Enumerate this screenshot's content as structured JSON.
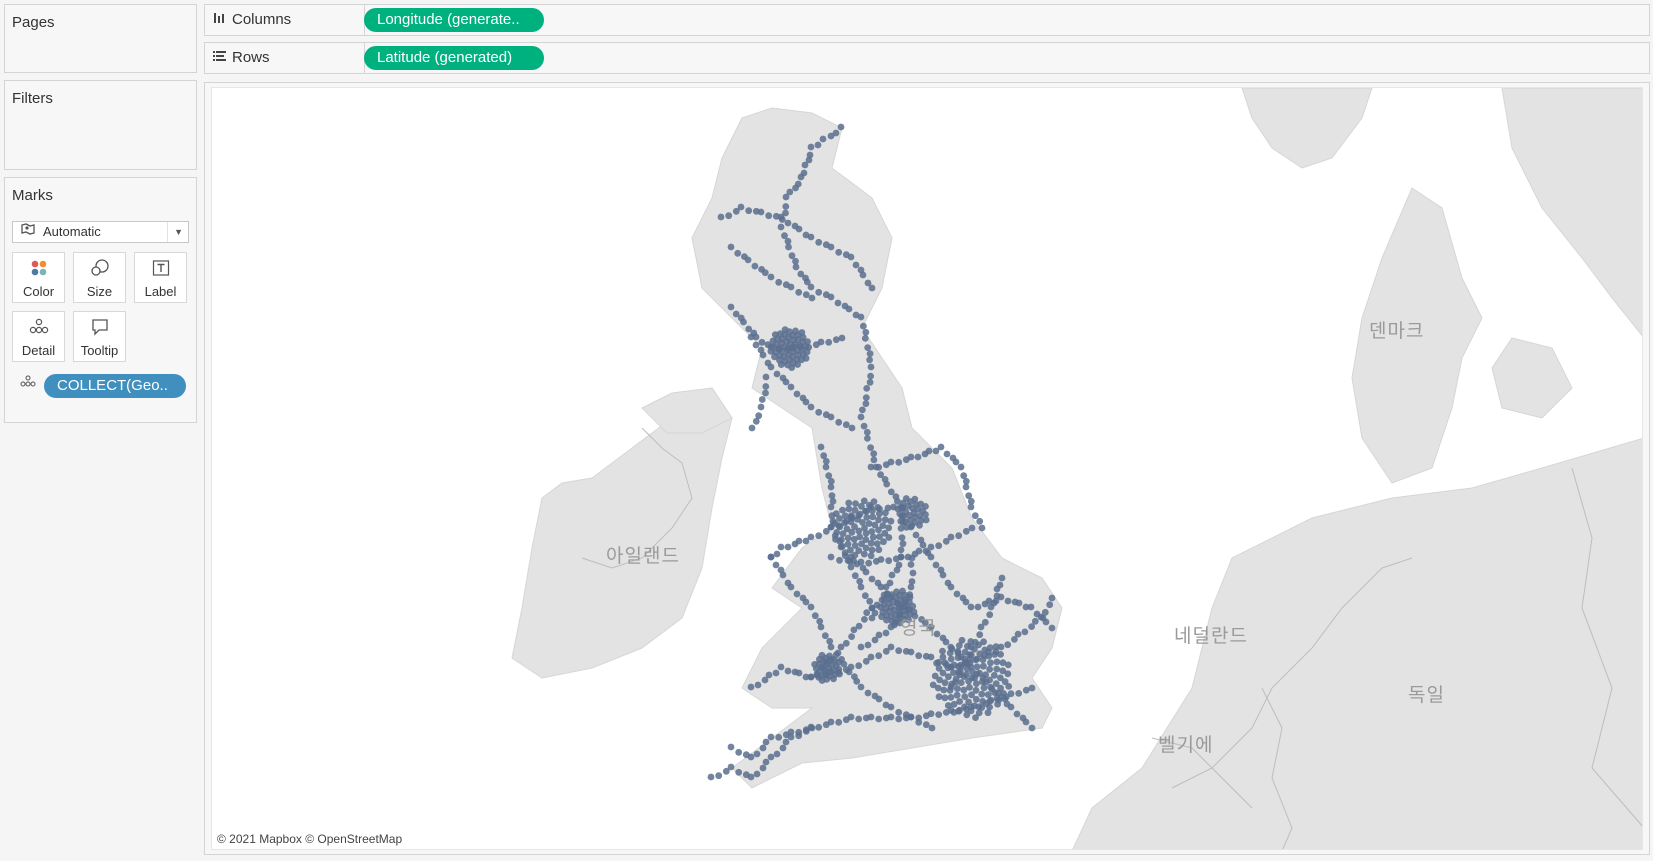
{
  "pages": {
    "title": "Pages"
  },
  "filters": {
    "title": "Filters"
  },
  "marks": {
    "title": "Marks",
    "mark_type": "Automatic",
    "mark_type_icon": "map-symbol-icon",
    "buttons": [
      {
        "label": "Color",
        "icon": "color-dots-icon"
      },
      {
        "label": "Size",
        "icon": "size-circles-icon"
      },
      {
        "label": "Label",
        "icon": "label-t-icon"
      },
      {
        "label": "Detail",
        "icon": "detail-dots-icon"
      },
      {
        "label": "Tooltip",
        "icon": "tooltip-bubble-icon"
      }
    ],
    "field": {
      "label": "COLLECT(Geo..",
      "icon": "detail-dots-icon",
      "color": "#3f8fbf"
    }
  },
  "shelves": {
    "columns": {
      "label": "Columns",
      "pill": "Longitude (generate..",
      "icon": "columns-icon"
    },
    "rows": {
      "label": "Rows",
      "pill": "Latitude (generated)",
      "icon": "rows-icon"
    },
    "pill_color": "#00b180"
  },
  "map": {
    "country_labels": {
      "ireland": "아일랜드",
      "uk": "영국",
      "netherlands": "네덜란드",
      "belgium": "벨기에",
      "germany": "독일",
      "denmark": "덴마크"
    },
    "attribution": "© 2021 Mapbox © OpenStreetMap",
    "land_color": "#e3e3e3",
    "water_color": "#ffffff",
    "mark_color": "#5a6f8e"
  }
}
